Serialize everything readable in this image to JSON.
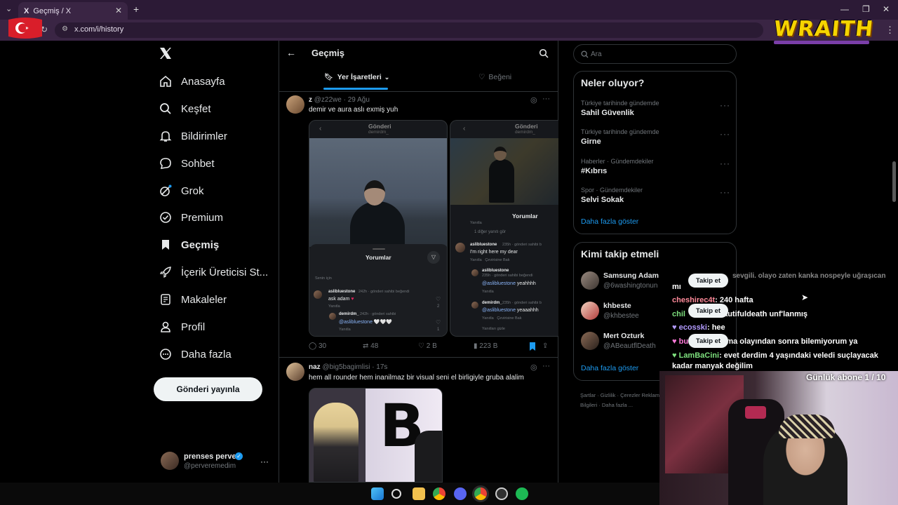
{
  "browser": {
    "tab_title": "Geçmiş / X",
    "tab_favicon": "X",
    "url": "x.com/i/history",
    "win_min": "—",
    "win_max": "❐",
    "win_close": "✕"
  },
  "nav": {
    "items": [
      {
        "label": "Anasayfa",
        "icon": "home-icon"
      },
      {
        "label": "Keşfet",
        "icon": "search-icon"
      },
      {
        "label": "Bildirimler",
        "icon": "bell-icon"
      },
      {
        "label": "Sohbet",
        "icon": "chat-icon"
      },
      {
        "label": "Grok",
        "icon": "grok-icon"
      },
      {
        "label": "Premium",
        "icon": "premium-icon"
      },
      {
        "label": "Geçmiş",
        "icon": "bookmark-icon"
      },
      {
        "label": "İçerik Üreticisi St...",
        "icon": "rocket-icon"
      },
      {
        "label": "Makaleler",
        "icon": "article-icon"
      },
      {
        "label": "Profil",
        "icon": "profile-icon"
      },
      {
        "label": "Daha fazla",
        "icon": "more-icon"
      }
    ],
    "post_button": "Gönderi yayınla",
    "account": {
      "name": "prenses perver",
      "handle": "@perveremedim"
    }
  },
  "header": {
    "title": "Geçmiş",
    "tabs": [
      {
        "label": "Yer İşaretleri"
      },
      {
        "label": "Beğeni"
      }
    ]
  },
  "tweets": [
    {
      "name": "z",
      "handle": "@z22we",
      "time": "· 29 Ağu",
      "text": "demir ve aura aslı exmiş yuh",
      "replies": "30",
      "retweets": "48",
      "likes": "2 B",
      "views": "223 B",
      "media": {
        "left": {
          "title": "Gönderi",
          "sub": "demirdm_",
          "comments_label": "Yorumlar",
          "for_you": "Senin için",
          "c1_user": "aslibluestone",
          "c1_meta": "242h · gönderi sahibi beğendi",
          "c1_text": "ask adam",
          "reply": "Yanıtla",
          "c1_likes": "2",
          "c2_user": "demirdm_",
          "c2_meta": "242h · gönderi sahibi",
          "c2_mention": "@aslibluestone",
          "c2_hearts": "🤍🤍🤍",
          "c2_likes": "1"
        },
        "right": {
          "title": "Gönderi",
          "sub": "demirdm_",
          "comments_label": "Yorumlar",
          "reply": "Yanıtla",
          "more_replies": "1 diğer yanıtı gör",
          "c1_user": "aslibluestone",
          "c1_meta": "235h · gönderi sahibi b",
          "c1_text": "I'm right here my dear",
          "translate": "Çevirisine Bak",
          "c2_user": "aslibluestone",
          "c2_meta": "235h · gönderi sahibi beğendi",
          "c2_mention": "@aslibluestone",
          "c2_text": "yeahhhh",
          "c3_user": "demirdm_",
          "c3_meta": "235h · gönderi sahibi b",
          "c3_mention": "@aslibluestone",
          "c3_text": "yeaaahhh",
          "hide": "Yanıtları gizle"
        }
      }
    },
    {
      "name": "naz",
      "handle": "@big5bagimlisi",
      "time": "· 17s",
      "text": "hem all rounder hem inanilmaz bir visual seni el birligiyle gruba alalim"
    }
  ],
  "right": {
    "search_placeholder": "Ara",
    "trends_title": "Neler oluyor?",
    "trends": [
      {
        "sub": "Türkiye tarihinde gündemde",
        "title": "Sahil Güvenlik"
      },
      {
        "sub": "Türkiye tarihinde gündemde",
        "title": "Girne"
      },
      {
        "sub": "Haberler · Gündemdekiler",
        "title": "#Kıbrıs"
      },
      {
        "sub": "Spor · Gündemdekiler",
        "title": "Selvi Sokak"
      }
    ],
    "show_more": "Daha fazla göster",
    "who_title": "Kimi takip etmeli",
    "who": [
      {
        "name": "Samsung Adam",
        "handle": "@6washingtonun"
      },
      {
        "name": "khbeste",
        "handle": "@khbestee"
      },
      {
        "name": "Mert Ozturk",
        "handle": "@ABeautflDeath"
      }
    ],
    "follow_label": "Takip et",
    "who_more": "Daha fazla göster",
    "footer": [
      "Şartlar",
      "Gizlilik",
      "Çerezler",
      "Reklam Bilgileri",
      "Daha fazla ..."
    ]
  },
  "stream": {
    "brand": "WRAITH",
    "sub_goal": "Günlük abone 1 / 10",
    "chat": [
      {
        "user": "",
        "text": "mı"
      },
      {
        "user": "cheshirec4t",
        "text": ": 240 hafta",
        "color": "#ff8a9a"
      },
      {
        "user": "chil",
        "text": "eautifuldeath unf'lanmış",
        "color": "#7ee07e"
      },
      {
        "user": "ecosski",
        "text": ": hee",
        "color": "#b39bff"
      },
      {
        "user": "bur",
        "text": "halama olayından sonra bilemiyorum ya",
        "color": "#ff7ad9"
      },
      {
        "user": "LamBaCini",
        "text": ": evet derdim 4 yaşındaki veledi suçlayacak kadar manyak değilim",
        "color": "#7ee07e"
      }
    ],
    "chat_top_fragment": "sevgili. olayo zaten kanka nospeyle uğraşıcan"
  },
  "colors": {
    "accent": "#1d9bf0",
    "bg": "#000000",
    "chrome": "#2c1a36"
  }
}
